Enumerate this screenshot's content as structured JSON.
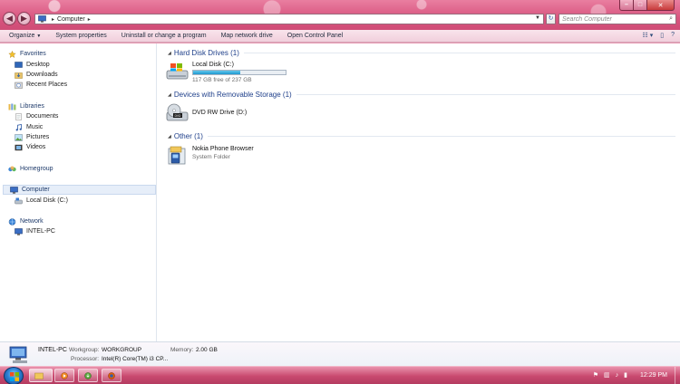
{
  "window": {
    "controls": {
      "minimize": "–",
      "maximize": "□",
      "close": "✕"
    }
  },
  "address_bar": {
    "breadcrumb": [
      "Computer"
    ],
    "search_placeholder": "Search Computer"
  },
  "command_bar": {
    "items": [
      {
        "label": "Organize",
        "has_dropdown": true
      },
      {
        "label": "System properties"
      },
      {
        "label": "Uninstall or change a program"
      },
      {
        "label": "Map network drive"
      },
      {
        "label": "Open Control Panel"
      }
    ]
  },
  "nav_pane": {
    "favorites": {
      "label": "Favorites",
      "items": [
        "Desktop",
        "Downloads",
        "Recent Places"
      ]
    },
    "libraries": {
      "label": "Libraries",
      "items": [
        "Documents",
        "Music",
        "Pictures",
        "Videos"
      ]
    },
    "homegroup": {
      "label": "Homegroup"
    },
    "computer": {
      "label": "Computer",
      "items": [
        "Local Disk (C:)"
      ],
      "selected": true
    },
    "network": {
      "label": "Network",
      "items": [
        "INTEL-PC"
      ]
    }
  },
  "content": {
    "groups": [
      {
        "title": "Hard Disk Drives (1)",
        "items": [
          {
            "name": "Local Disk (C:)",
            "detail": "117 GB free of 237 GB",
            "used_fraction": 0.506,
            "icon": "hard-disk-icon"
          }
        ]
      },
      {
        "title": "Devices with Removable Storage (1)",
        "items": [
          {
            "name": "DVD RW Drive (D:)",
            "icon": "dvd-drive-icon"
          }
        ]
      },
      {
        "title": "Other (1)",
        "items": [
          {
            "name": "Nokia Phone Browser",
            "detail": "System Folder",
            "icon": "phone-folder-icon"
          }
        ]
      }
    ]
  },
  "details_pane": {
    "computer_name": "INTEL-PC",
    "workgroup_label": "Workgroup:",
    "workgroup_value": "WORKGROUP",
    "memory_label": "Memory:",
    "memory_value": "2.00 GB",
    "processor_label": "Processor:",
    "processor_value": "Intel(R) Core(TM) i3 CP..."
  },
  "taskbar": {
    "clock": "12:29 PM"
  },
  "colors": {
    "accent": "#d8557f",
    "group_header": "#1e3f8a",
    "disk_fill": "#1e98cf"
  }
}
